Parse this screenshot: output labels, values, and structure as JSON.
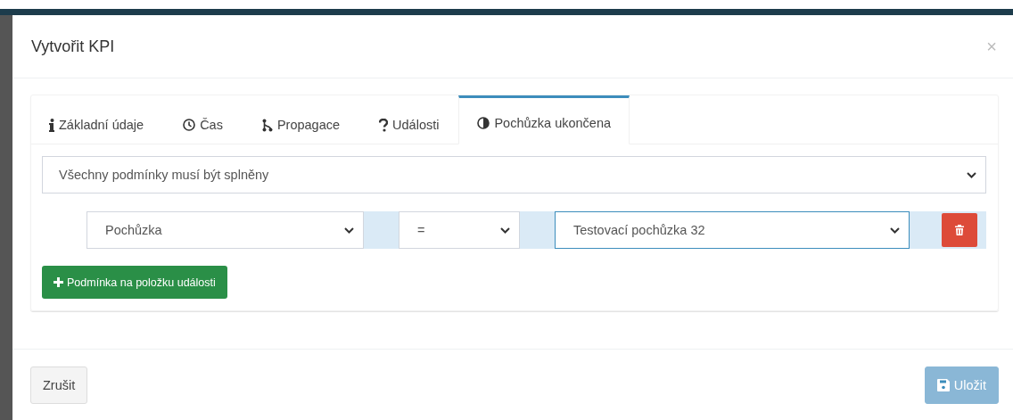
{
  "dialog": {
    "title": "Vytvořit KPI",
    "close": "×"
  },
  "tabs": [
    {
      "label": "Základní údaje",
      "kind": "info",
      "selected": false
    },
    {
      "label": "Čas",
      "kind": "time",
      "selected": false
    },
    {
      "label": "Propagace",
      "kind": "propagation",
      "selected": false
    },
    {
      "label": "Události",
      "kind": "events",
      "selected": false
    },
    {
      "label": "Pochůzka ukončena",
      "kind": "finished",
      "selected": true
    }
  ],
  "match_select": {
    "value": "Všechny podmínky musí být splněny"
  },
  "conditions": [
    {
      "field": {
        "value": "Pochůzka",
        "focused": false
      },
      "operator": {
        "value": "=",
        "focused": false
      },
      "target": {
        "value": "Testovací pochůzka 32",
        "focused": true
      }
    }
  ],
  "add_condition_button": {
    "label": "Podmínka na položku události"
  },
  "footer": {
    "cancel": {
      "label": "Zrušit",
      "disabled": false
    },
    "save": {
      "label": "Uložit",
      "disabled": true
    }
  }
}
